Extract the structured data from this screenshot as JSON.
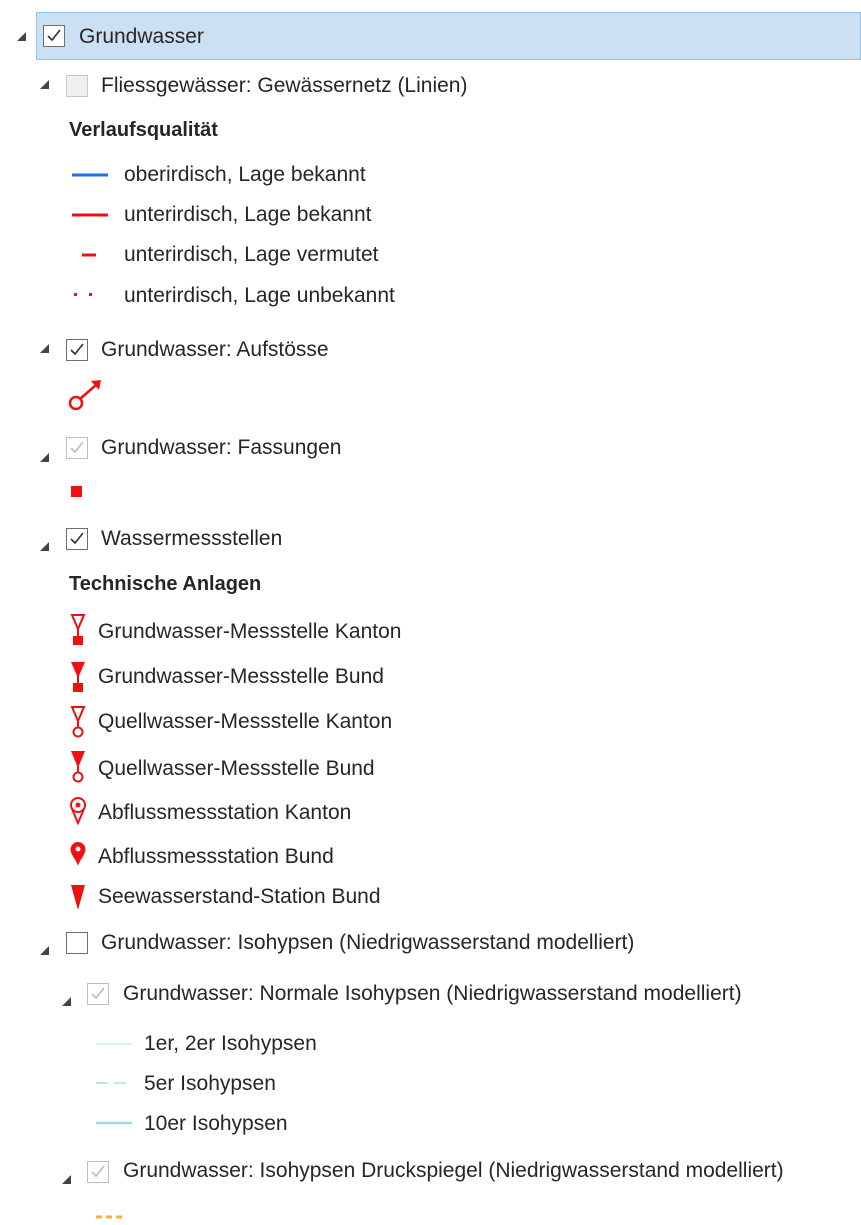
{
  "tree": {
    "root": {
      "label": "Grundwasser",
      "checked": true
    },
    "layer_fliess": {
      "label": "Fliessgewässer: Gewässernetz (Linien)",
      "checked": false,
      "group_heading": "Verlaufsqualität",
      "legend": [
        {
          "label": "oberirdisch, Lage bekannt",
          "symbol": "solid-blue-line",
          "color": "#1f6fe6"
        },
        {
          "label": "unterirdisch, Lage bekannt",
          "symbol": "solid-red-line",
          "color": "#ee1111"
        },
        {
          "label": "unterirdisch, Lage vermutet",
          "symbol": "dashed-red-line",
          "color": "#ee1111"
        },
        {
          "label": "unterirdisch, Lage unbekannt",
          "symbol": "dotted-red-line",
          "color": "#ee1111"
        }
      ]
    },
    "layer_aufstoesse": {
      "label": "Grundwasser: Aufstösse",
      "checked": true,
      "symbol": "spring-outlet-icon"
    },
    "layer_fassungen": {
      "label": "Grundwasser: Fassungen",
      "checked": true,
      "symbol": "red-square-icon"
    },
    "layer_messstellen": {
      "label": "Wassermessstellen",
      "checked": true,
      "group_heading": "Technische Anlagen",
      "legend": [
        {
          "label": "Grundwasser-Messstelle Kanton",
          "symbol": "triangle-square-outline-icon"
        },
        {
          "label": "Grundwasser-Messstelle Bund",
          "symbol": "triangle-square-filled-icon"
        },
        {
          "label": "Quellwasser-Messstelle Kanton",
          "symbol": "triangle-circle-outline-icon"
        },
        {
          "label": "Quellwasser-Messstelle Bund",
          "symbol": "triangle-circle-filled-icon"
        },
        {
          "label": "Abflussmessstation Kanton",
          "symbol": "pin-outline-icon"
        },
        {
          "label": "Abflussmessstation Bund",
          "symbol": "pin-filled-icon"
        },
        {
          "label": "Seewasserstand-Station Bund",
          "symbol": "triangle-down-filled-icon"
        }
      ]
    },
    "layer_isohypsen": {
      "label": "Grundwasser: Isohypsen (Niedrigwasserstand modelliert)",
      "checked": false
    },
    "layer_normale": {
      "label": "Grundwasser: Normale Isohypsen (Niedrigwasserstand modelliert)",
      "checked": true,
      "legend": [
        {
          "label": "1er, 2er Isohypsen",
          "symbol": "thin-light-blue-line",
          "color": "#d9eef8"
        },
        {
          "label": "5er Isohypsen",
          "symbol": "dashed-light-blue-line",
          "color": "#bfe3f5"
        },
        {
          "label": "10er Isohypsen",
          "symbol": "solid-light-blue-line",
          "color": "#9fd5ef"
        }
      ]
    },
    "layer_druckspiegel": {
      "label": "Grundwasser: Isohypsen Druckspiegel (Niedrigwasserstand modelliert)",
      "checked": true,
      "symbol": "dashed-orange-line",
      "color": "#f5b041"
    }
  }
}
